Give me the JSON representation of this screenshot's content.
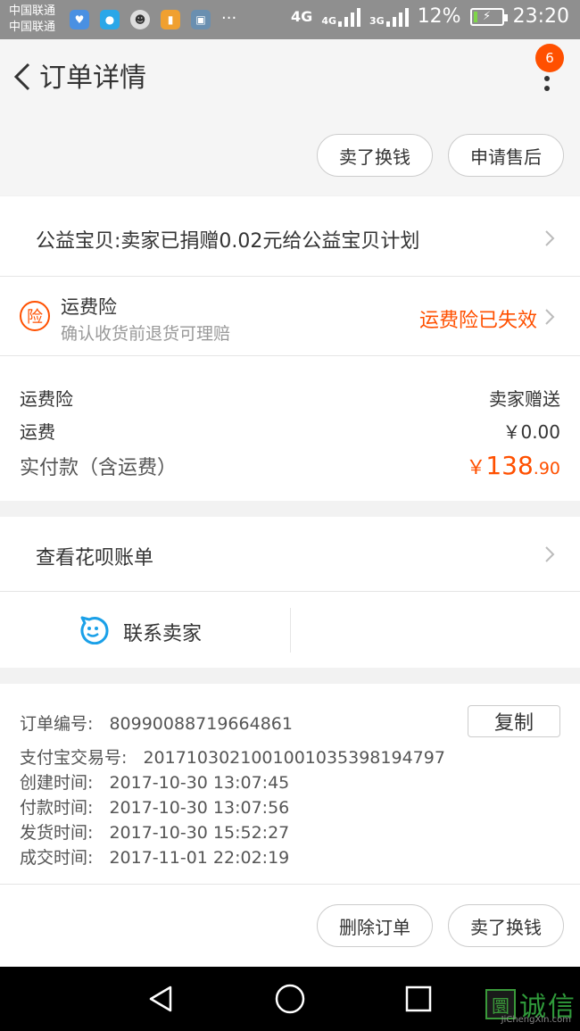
{
  "status_bar": {
    "carrier1": "中国联通",
    "carrier2": "中国联通",
    "network1": "4G",
    "network2": "4G",
    "network3": "3G",
    "battery_pct": "12%",
    "battery_level": 0.12,
    "time": "23:20",
    "app_icons": [
      "health-icon",
      "message-icon",
      "avatar-icon",
      "lock-app-icon",
      "gallery-icon"
    ],
    "more_dots": "···"
  },
  "header": {
    "title": "订单详情",
    "badge_count": "6",
    "top_buttons": [
      "卖了换钱",
      "申请售后"
    ]
  },
  "charity": {
    "text": "公益宝贝:卖家已捐赠0.02元给公益宝贝计划"
  },
  "insurance": {
    "icon_char": "险",
    "title": "运费险",
    "subtitle": "确认收货前退货可理赔",
    "status": "运费险已失效"
  },
  "costs": {
    "insurance_label": "运费险",
    "insurance_value": "卖家赠送",
    "shipping_label": "运费",
    "shipping_value": "￥0.00",
    "paid_label": "实付款（含运费）",
    "paid_currency": "￥",
    "paid_int": "138",
    "paid_dec": ".90"
  },
  "huabei": {
    "label": "查看花呗账单"
  },
  "contact": {
    "label": "联系卖家"
  },
  "order_info": {
    "copy_label": "复制",
    "lines": [
      {
        "label": "订单编号:",
        "value": "80990088719664861"
      },
      {
        "label": "支付宝交易号:",
        "value": "2017103021001001035398194797"
      },
      {
        "label": "创建时间:",
        "value": "2017-10-30 13:07:45"
      },
      {
        "label": "付款时间:",
        "value": "2017-10-30 13:07:56"
      },
      {
        "label": "发货时间:",
        "value": "2017-10-30 15:52:27"
      },
      {
        "label": "成交时间:",
        "value": "2017-11-01 22:02:19"
      }
    ]
  },
  "bottom_actions": [
    "删除订单",
    "卖了换钱"
  ],
  "watermark": {
    "logo_char": "圜",
    "text": "诚信",
    "sub": "JiChengXin.com"
  },
  "colors": {
    "accent": "#ff5000",
    "status_bar": "#8f8f8f",
    "background": "#f2f2f2"
  }
}
